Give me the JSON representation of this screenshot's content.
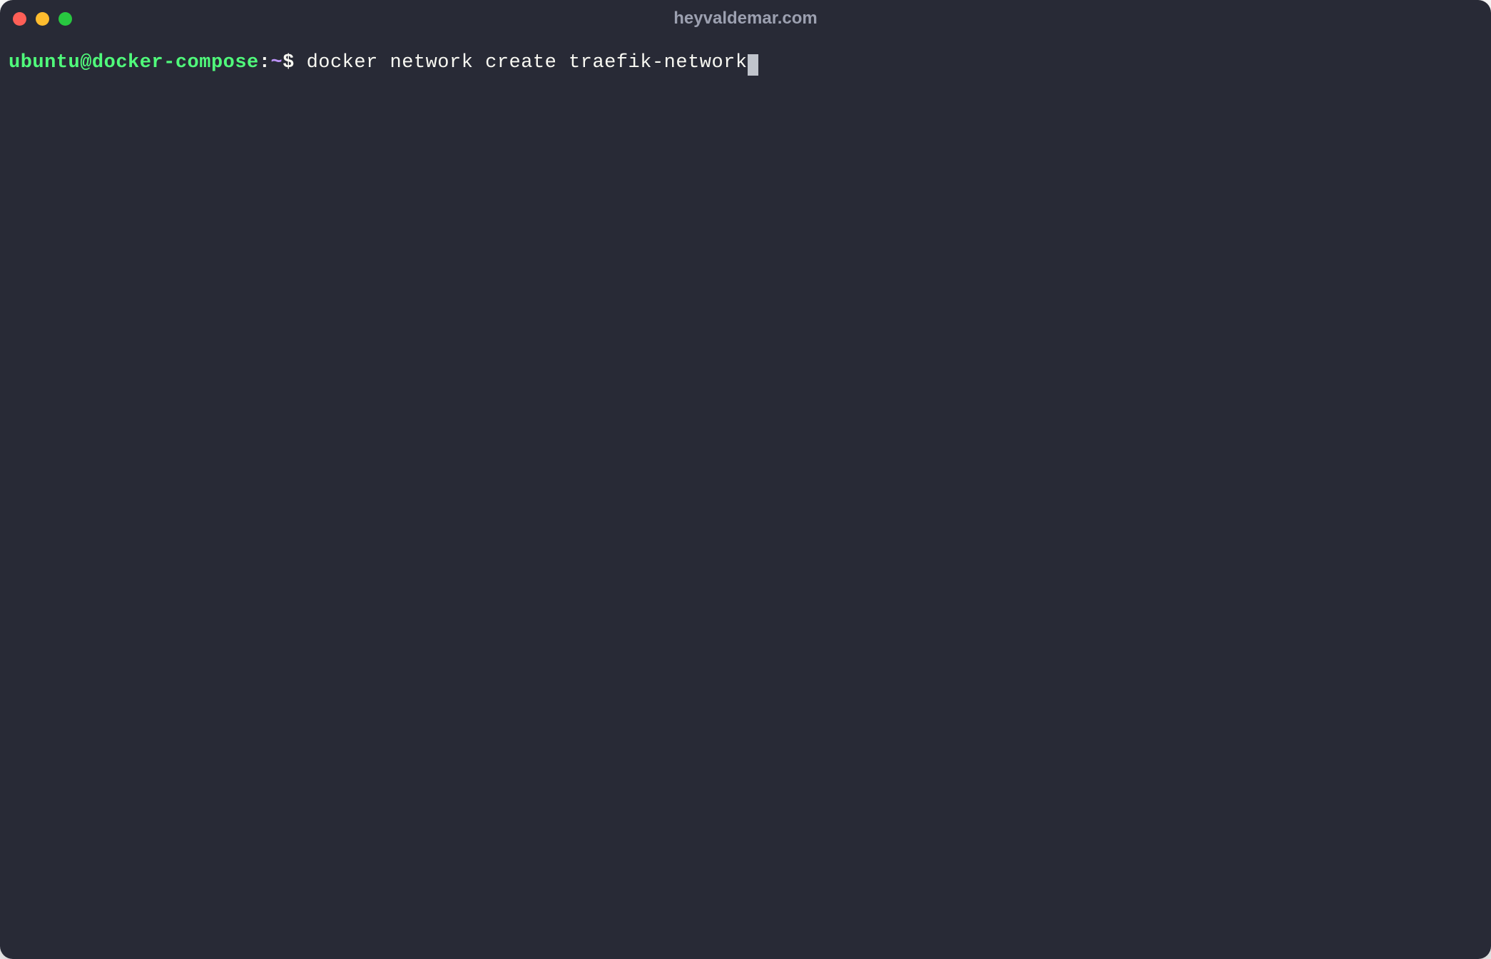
{
  "window": {
    "title": "heyvaldemar.com"
  },
  "colors": {
    "close": "#ff5f57",
    "minimize": "#febc2e",
    "maximize": "#28c840",
    "background": "#282a36",
    "prompt_user_host": "#50fa7b",
    "prompt_path": "#bd93f9",
    "text": "#f8f8f2"
  },
  "terminal": {
    "prompt": {
      "user_host": "ubuntu@docker-compose",
      "colon": ":",
      "path": "~",
      "symbol": "$ "
    },
    "command": "docker network create traefik-network"
  }
}
